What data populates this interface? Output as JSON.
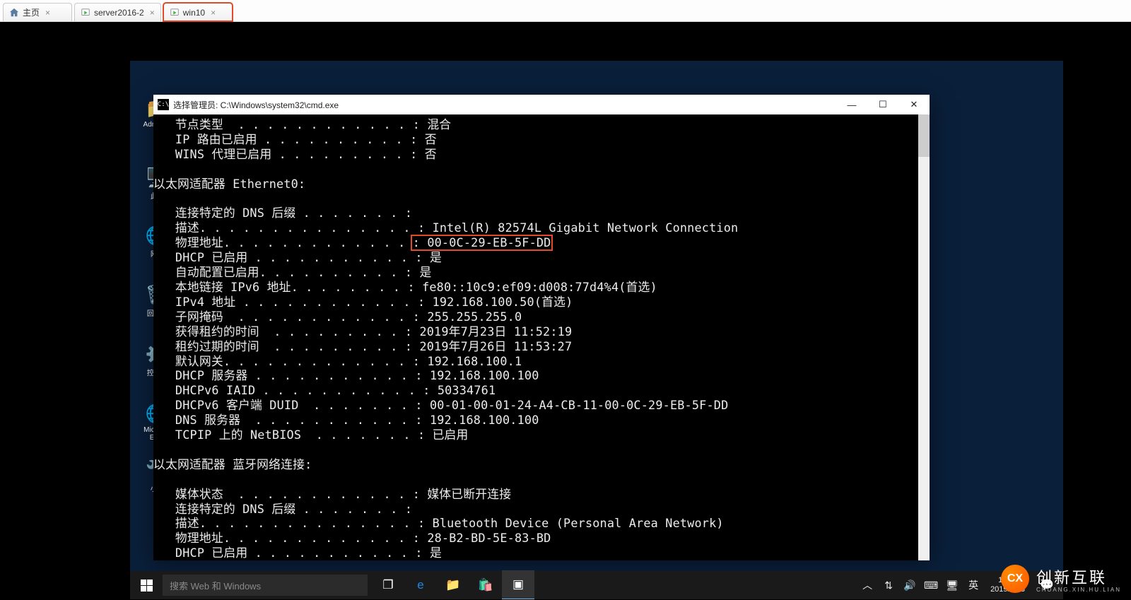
{
  "tabs": [
    {
      "label": "主页",
      "icon": "home",
      "highlight": false
    },
    {
      "label": "server2016-2",
      "icon": "vm-green",
      "highlight": false
    },
    {
      "label": "win10",
      "icon": "vm-green",
      "highlight": true
    }
  ],
  "desktop_icons": {
    "admin": "Admini...",
    "pc": "此...",
    "net": "网...",
    "bin": "回收...",
    "cp": "控制...",
    "edge": "Micros...\nEd...",
    "tool": "小..."
  },
  "cmd": {
    "title": "选择管理员: C:\\Windows\\system32\\cmd.exe",
    "highlight_mac": "00-0C-29-EB-5F-DD",
    "lines_top": [
      "   节点类型  . . . . . . . . . . . . : 混合",
      "   IP 路由已启用 . . . . . . . . . . : 否",
      "   WINS 代理已启用 . . . . . . . . . : 否",
      "",
      "以太网适配器 Ethernet0:",
      "",
      "   连接特定的 DNS 后缀 . . . . . . . :",
      "   描述. . . . . . . . . . . . . . . : Intel(R) 82574L Gigabit Network Connection"
    ],
    "mac_line_prefix": "   物理地址. . . . . . . . . . . . . ",
    "mac_line_value": ": 00-0C-29-EB-5F-DD",
    "lines_mid": [
      "   DHCP 已启用 . . . . . . . . . . . : 是",
      "   自动配置已启用. . . . . . . . . . : 是",
      "   本地链接 IPv6 地址. . . . . . . . : fe80::10c9:ef09:d008:77d4%4(首选)",
      "   IPv4 地址 . . . . . . . . . . . . : 192.168.100.50(首选)",
      "   子网掩码  . . . . . . . . . . . . : 255.255.255.0",
      "   获得租约的时间  . . . . . . . . . : 2019年7月23日 11:52:19",
      "   租约过期的时间  . . . . . . . . . : 2019年7月26日 11:53:27",
      "   默认网关. . . . . . . . . . . . . : 192.168.100.1",
      "   DHCP 服务器 . . . . . . . . . . . : 192.168.100.100",
      "   DHCPv6 IAID . . . . . . . . . . . : 50334761",
      "   DHCPv6 客户端 DUID  . . . . . . . : 00-01-00-01-24-A4-CB-11-00-0C-29-EB-5F-DD",
      "   DNS 服务器  . . . . . . . . . . . : 192.168.100.100",
      "   TCPIP 上的 NetBIOS  . . . . . . . : 已启用",
      "",
      "以太网适配器 蓝牙网络连接:",
      "",
      "   媒体状态  . . . . . . . . . . . . : 媒体已断开连接",
      "   连接特定的 DNS 后缀 . . . . . . . :",
      "   描述. . . . . . . . . . . . . . . : Bluetooth Device (Personal Area Network)",
      "   物理地址. . . . . . . . . . . . . : 28-B2-BD-5E-83-BD",
      "   DHCP 已启用 . . . . . . . . . . . : 是"
    ]
  },
  "taskbar": {
    "search_placeholder": "搜索 Web 和 Windows",
    "ime": "英",
    "time": "11:57",
    "date": "2019/7/23"
  },
  "watermark": {
    "logo": "CX",
    "text": "创新互联",
    "sub": "CHUANG.XIN.HU.LIAN"
  }
}
